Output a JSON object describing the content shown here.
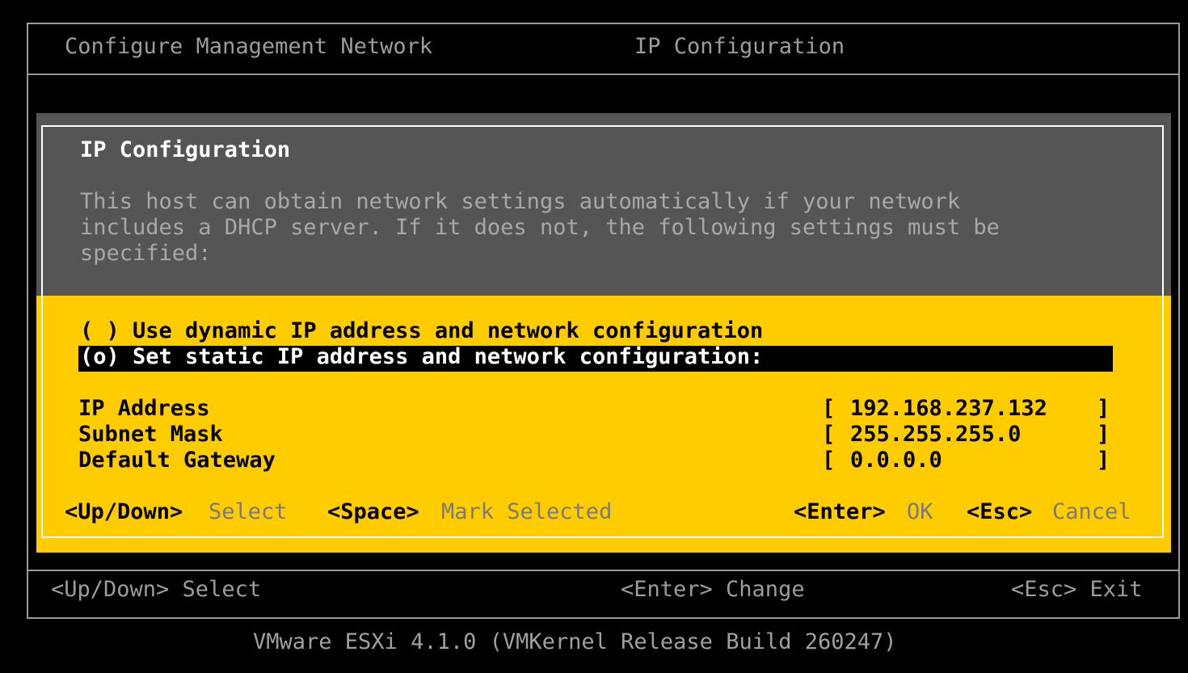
{
  "header": {
    "left_title": "Configure Management Network",
    "right_title": "IP Configuration"
  },
  "dialog": {
    "title": "IP Configuration",
    "description": [
      "This host can obtain network settings automatically if your network",
      "includes a DHCP server. If it does not, the following settings must be",
      "specified:"
    ],
    "options": [
      {
        "label": "( ) Use dynamic IP address and network configuration",
        "selected": false
      },
      {
        "label": "(o) Set static IP address and network configuration:",
        "selected": true
      }
    ],
    "fields": [
      {
        "label": "IP Address",
        "open": "[",
        "value": "192.168.237.132",
        "close": "]"
      },
      {
        "label": "Subnet Mask",
        "open": "[",
        "value": "255.255.255.0",
        "close": "]"
      },
      {
        "label": "Default Gateway",
        "open": "[",
        "value": "0.0.0.0",
        "close": "]"
      }
    ],
    "hints": {
      "updown_key": "<Up/Down>",
      "updown_action": "Select",
      "space_key": "<Space>",
      "space_action": "Mark Selected",
      "enter_key": "<Enter>",
      "enter_action": "OK",
      "esc_key": "<Esc>",
      "esc_action": "Cancel"
    }
  },
  "footer": {
    "left": "<Up/Down> Select",
    "center": "<Enter> Change",
    "right": "<Esc> Exit",
    "version": "VMware ESXi 4.1.0 (VMKernel Release Build 260247)"
  },
  "colors": {
    "background": "#000000",
    "dialog_header": "#555555",
    "dialog_body": "#ffcc00",
    "border": "#ffffff"
  }
}
